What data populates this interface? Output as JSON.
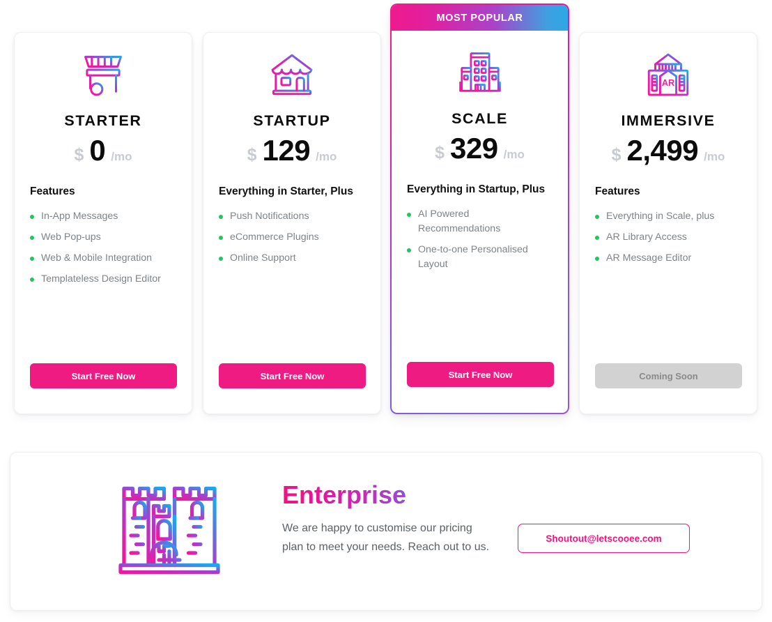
{
  "colors": {
    "accent_pink": "#ee1b83",
    "gradient_start": "#ef1a8e",
    "gradient_end": "#2ea8e6",
    "bullet_green": "#22c55e",
    "muted_text": "#7e8489",
    "disabled_button": "#d2d2d2"
  },
  "popular_badge": "MOST POPULAR",
  "plans": [
    {
      "name": "STARTER",
      "currency": "$",
      "amount": "0",
      "period": "/mo",
      "icon": "market-cart-icon",
      "features_title": "Features",
      "features": [
        "In-App Messages",
        "Web Pop-ups",
        "Web & Mobile Integration",
        "Templateless Design Editor"
      ],
      "cta_label": "Start Free Now",
      "cta_disabled": false
    },
    {
      "name": "STARTUP",
      "currency": "$",
      "amount": "129",
      "period": "/mo",
      "icon": "storefront-icon",
      "features_title": "Everything in Starter, Plus",
      "features": [
        "Push Notifications",
        "eCommerce Plugins",
        "Online Support"
      ],
      "cta_label": "Start Free Now",
      "cta_disabled": false
    },
    {
      "name": "SCALE",
      "currency": "$",
      "amount": "329",
      "period": "/mo",
      "icon": "office-building-icon",
      "features_title": "Everything in Startup, Plus",
      "features": [
        "AI Powered Recommendations",
        "One-to-one Personalised Layout"
      ],
      "cta_label": "Start Free Now",
      "cta_disabled": false,
      "badge": "MOST POPULAR"
    },
    {
      "name": "IMMERSIVE",
      "currency": "$",
      "amount": "2,499",
      "period": "/mo",
      "icon": "ar-museum-icon",
      "features_title": "Features",
      "features": [
        "Everything in Scale, plus",
        "AR Library Access",
        "AR Message Editor"
      ],
      "cta_label": "Coming Soon",
      "cta_disabled": true
    }
  ],
  "enterprise": {
    "icon": "castle-icon",
    "title": "Enterprise",
    "description": "We are happy to customise our pricing plan to meet your needs. Reach out to us.",
    "contact_label": "Shoutout@letscooee.com"
  }
}
